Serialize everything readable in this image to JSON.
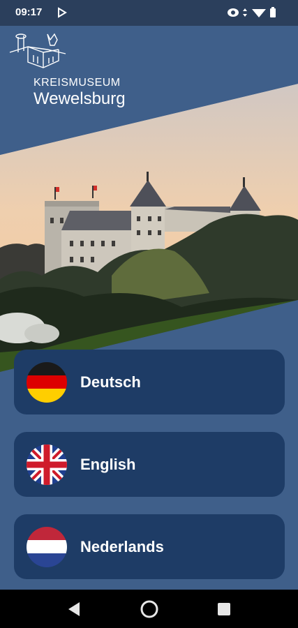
{
  "status_bar": {
    "time": "09:17"
  },
  "logo": {
    "line1": "KREISMUSEUM",
    "line2": "Wewelsburg"
  },
  "languages": [
    {
      "label": "Deutsch",
      "flag": "germany-flag"
    },
    {
      "label": "English",
      "flag": "uk-flag"
    },
    {
      "label": "Nederlands",
      "flag": "netherlands-flag"
    }
  ],
  "colors": {
    "header_blue": "#3f5f8a",
    "button_blue": "#1e3c66",
    "status_bar": "#2b3f5c"
  }
}
